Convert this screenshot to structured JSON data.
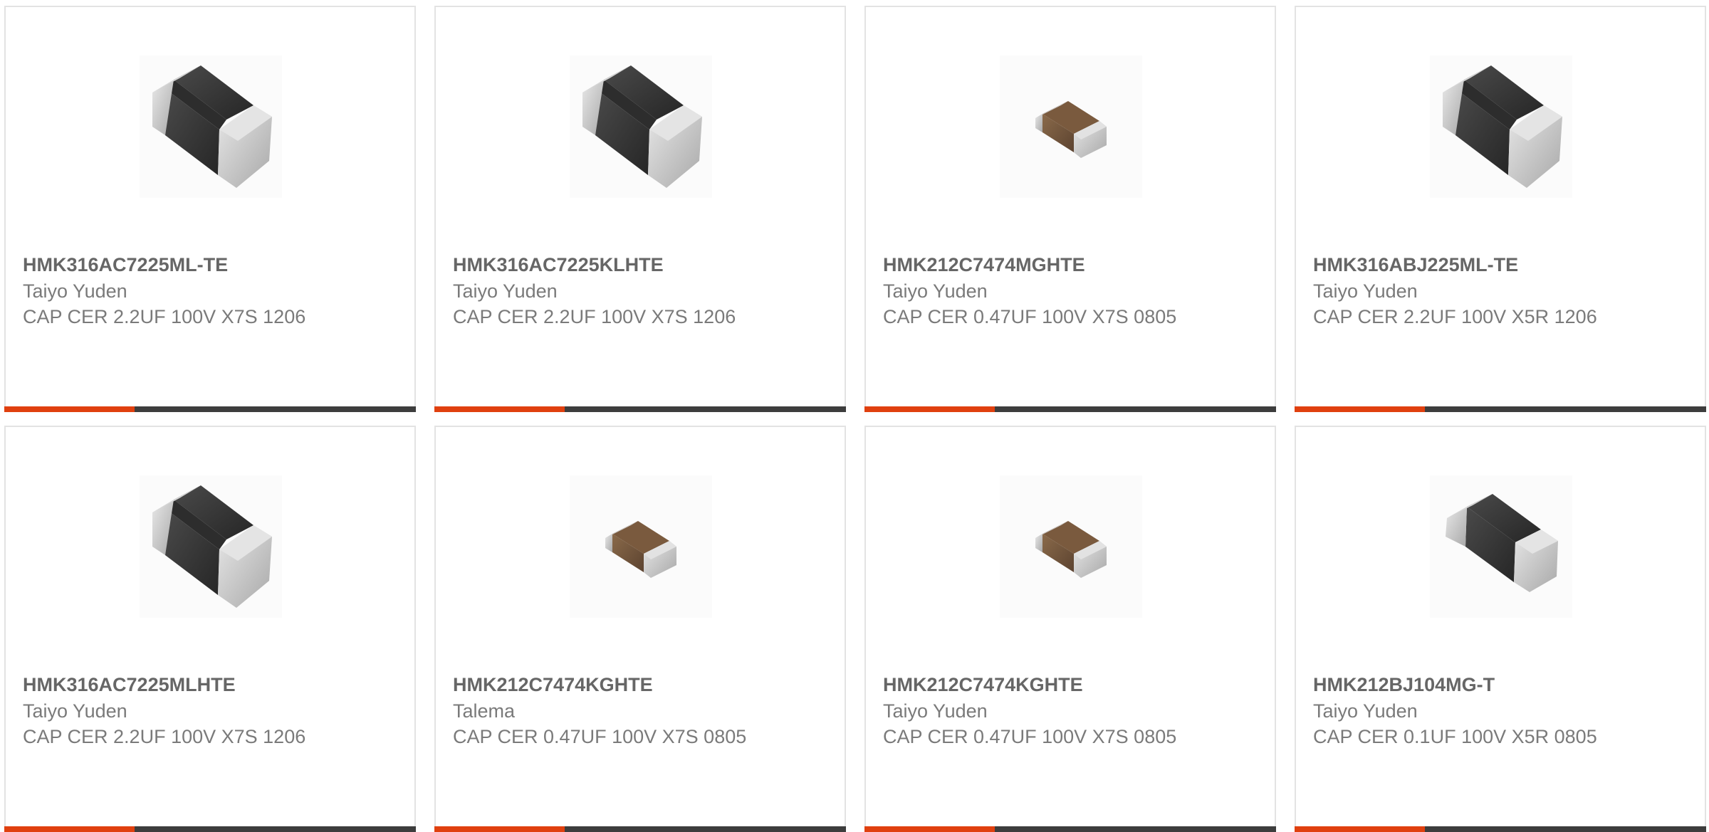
{
  "colors": {
    "accent": "#e0400f",
    "bar_dark": "#3d3d3d",
    "card_border": "#e3e3e3",
    "part_number_text": "#666666",
    "body_text": "#7a7a7a"
  },
  "products": [
    {
      "part_number": "HMK316AC7225ML-TE",
      "manufacturer": "Taiyo Yuden",
      "description": "CAP CER 2.2UF 100V X7S 1206",
      "image_icon": "capacitor-1206-icon"
    },
    {
      "part_number": "HMK316AC7225KLHTE",
      "manufacturer": "Taiyo Yuden",
      "description": "CAP CER 2.2UF 100V X7S 1206",
      "image_icon": "capacitor-1206-icon"
    },
    {
      "part_number": "HMK212C7474MGHTE",
      "manufacturer": "Taiyo Yuden",
      "description": "CAP CER 0.47UF 100V X7S 0805",
      "image_icon": "capacitor-0805-icon"
    },
    {
      "part_number": "HMK316ABJ225ML-TE",
      "manufacturer": "Taiyo Yuden",
      "description": "CAP CER 2.2UF 100V X5R 1206",
      "image_icon": "capacitor-1206-icon"
    },
    {
      "part_number": "HMK316AC7225MLHTE",
      "manufacturer": "Taiyo Yuden",
      "description": "CAP CER 2.2UF 100V X7S 1206",
      "image_icon": "capacitor-1206-icon"
    },
    {
      "part_number": "HMK212C7474KGHTE",
      "manufacturer": "Talema",
      "description": "CAP CER 0.47UF 100V X7S 0805",
      "image_icon": "capacitor-0805-icon"
    },
    {
      "part_number": "HMK212C7474KGHTE",
      "manufacturer": "Taiyo Yuden",
      "description": "CAP CER 0.47UF 100V X7S 0805",
      "image_icon": "capacitor-0805-icon"
    },
    {
      "part_number": "HMK212BJ104MG-T",
      "manufacturer": "Taiyo Yuden",
      "description": "CAP CER 0.1UF 100V X5R 0805",
      "image_icon": "capacitor-1206-short-icon"
    }
  ]
}
